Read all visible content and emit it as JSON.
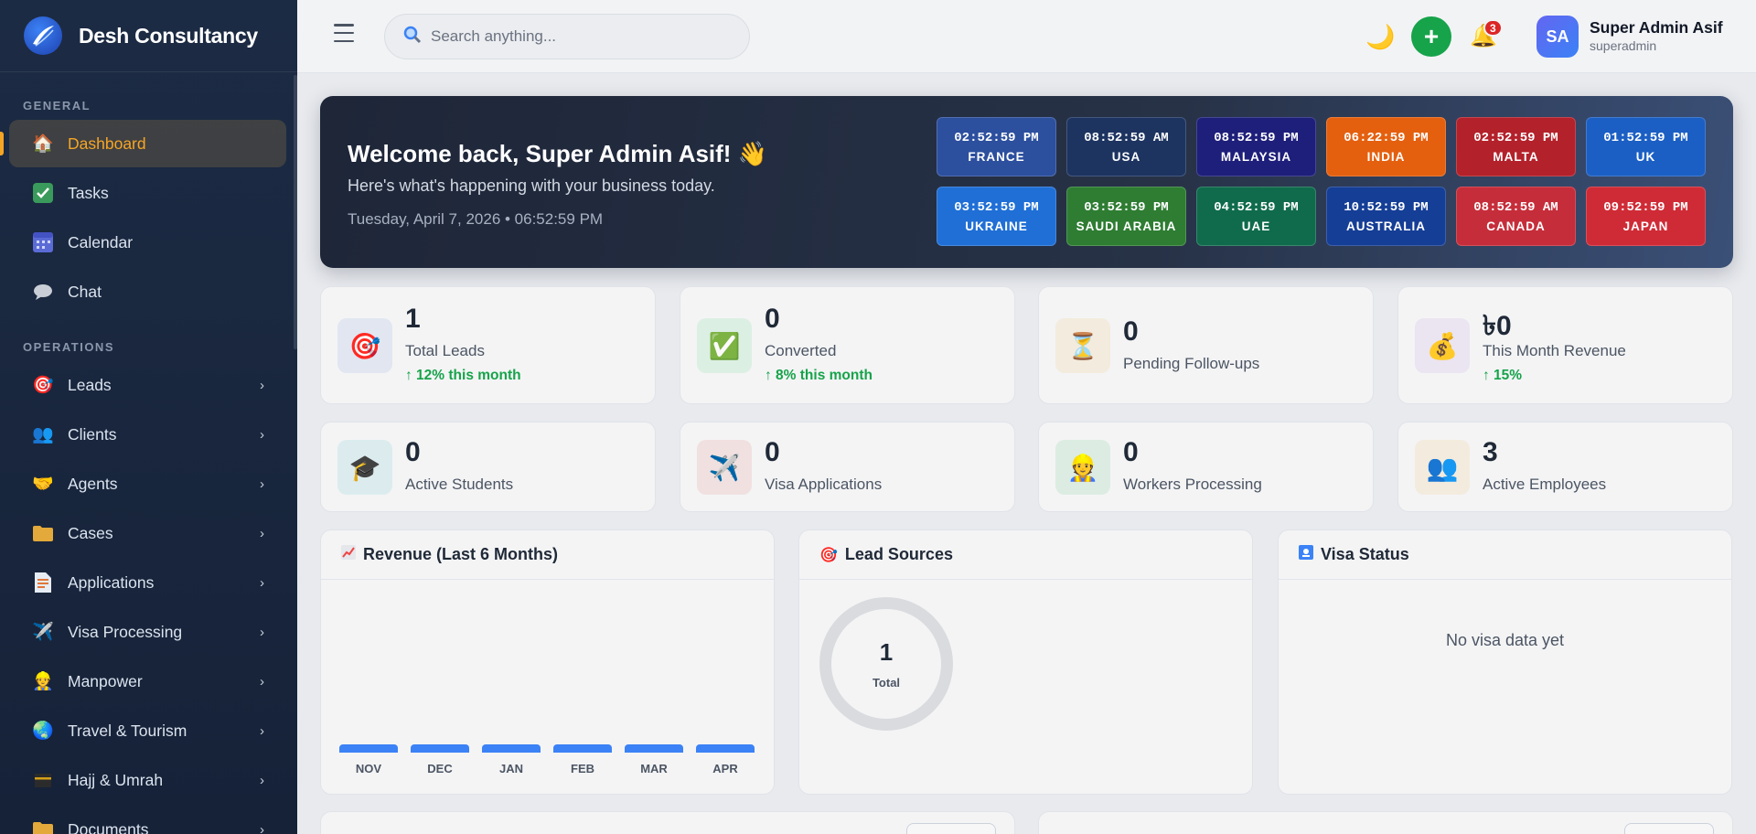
{
  "brand": {
    "name": "Desh Consultancy",
    "logo_icon": "swoosh-logo"
  },
  "sidebar": {
    "sections": [
      {
        "title": "GENERAL"
      },
      {
        "title": "OPERATIONS"
      }
    ],
    "general_items": [
      {
        "label": "Dashboard",
        "icon": "house-icon",
        "active": true
      },
      {
        "label": "Tasks",
        "icon": "check-box-icon"
      },
      {
        "label": "Calendar",
        "icon": "calendar-icon"
      },
      {
        "label": "Chat",
        "icon": "speech-bubble-icon"
      }
    ],
    "operations_items": [
      {
        "label": "Leads",
        "icon": "target-icon"
      },
      {
        "label": "Clients",
        "icon": "people-icon"
      },
      {
        "label": "Agents",
        "icon": "handshake-icon"
      },
      {
        "label": "Cases",
        "icon": "folder-icon"
      },
      {
        "label": "Applications",
        "icon": "document-icon"
      },
      {
        "label": "Visa Processing",
        "icon": "airplane-icon"
      },
      {
        "label": "Manpower",
        "icon": "worker-icon"
      },
      {
        "label": "Travel & Tourism",
        "icon": "globe-icon"
      },
      {
        "label": "Hajj & Umrah",
        "icon": "kaaba-icon"
      },
      {
        "label": "Documents",
        "icon": "folder-icon"
      }
    ],
    "chevron": "›",
    "active_color": "#f5a524"
  },
  "header": {
    "search_placeholder": "Search anything...",
    "notification_count": "3",
    "plus_label": "+",
    "user": {
      "initials": "SA",
      "name": "Super Admin Asif",
      "role": "superadmin"
    }
  },
  "banner": {
    "title": "Welcome back, Super Admin Asif! 👋",
    "subtitle": "Here's what's happening with your business today.",
    "date": "Tuesday, April 7, 2026 • 06:52:59 PM",
    "clocks": [
      {
        "time": "02:52:59 PM",
        "country": "FRANCE",
        "color": "#2c4f9e"
      },
      {
        "time": "08:52:59 AM",
        "country": "USA",
        "color": "#1d3461"
      },
      {
        "time": "08:52:59 PM",
        "country": "MALAYSIA",
        "color": "#1e1f7a"
      },
      {
        "time": "06:22:59 PM",
        "country": "INDIA",
        "color": "#e4600f"
      },
      {
        "time": "02:52:59 PM",
        "country": "MALTA",
        "color": "#b3212b"
      },
      {
        "time": "01:52:59 PM",
        "country": "UK",
        "color": "#1b5fc4"
      },
      {
        "time": "03:52:59 PM",
        "country": "UKRAINE",
        "color": "#1f6fd6"
      },
      {
        "time": "03:52:59 PM",
        "country": "SAUDI ARABIA",
        "color": "#2e7d32"
      },
      {
        "time": "04:52:59 PM",
        "country": "UAE",
        "color": "#0f6b4c"
      },
      {
        "time": "10:52:59 PM",
        "country": "AUSTRALIA",
        "color": "#153e96"
      },
      {
        "time": "08:52:59 AM",
        "country": "CANADA",
        "color": "#c62d3a"
      },
      {
        "time": "09:52:59 PM",
        "country": "JAPAN",
        "color": "#cf2b36"
      }
    ]
  },
  "stats": [
    {
      "value": "1",
      "label": "Total Leads",
      "trend": "↑ 12% this month",
      "icon": "target-icon",
      "bg": "#e1e6f1"
    },
    {
      "value": "0",
      "label": "Converted",
      "trend": "↑ 8% this month",
      "icon": "check-box-icon",
      "bg": "#dcefe3"
    },
    {
      "value": "0",
      "label": "Pending Follow-ups",
      "trend": "",
      "icon": "hourglass-icon",
      "bg": "#f3ebdd"
    },
    {
      "value": "৳0",
      "label": "This Month Revenue",
      "trend": "↑ 15%",
      "icon": "money-bag-icon",
      "bg": "#ebe4f1"
    },
    {
      "value": "0",
      "label": "Active Students",
      "trend": "",
      "icon": "graduation-cap-icon",
      "bg": "#dcecee"
    },
    {
      "value": "0",
      "label": "Visa Applications",
      "trend": "",
      "icon": "airplane-icon",
      "bg": "#f1e0e0"
    },
    {
      "value": "0",
      "label": "Workers Processing",
      "trend": "",
      "icon": "worker-icon",
      "bg": "#dcece2"
    },
    {
      "value": "3",
      "label": "Active Employees",
      "trend": "",
      "icon": "people-icon",
      "bg": "#f3ebdd"
    }
  ],
  "panels": {
    "revenue": {
      "title": "Revenue (Last 6 Months)",
      "icon": "chart-up-icon",
      "months": [
        "NOV",
        "DEC",
        "JAN",
        "FEB",
        "MAR",
        "APR"
      ]
    },
    "lead_sources": {
      "title": "Lead Sources",
      "icon": "target-icon",
      "total_value": "1",
      "total_label": "Total"
    },
    "visa_status": {
      "title": "Visa Status",
      "icon": "passport-icon",
      "empty_text": "No visa data yet"
    }
  }
}
